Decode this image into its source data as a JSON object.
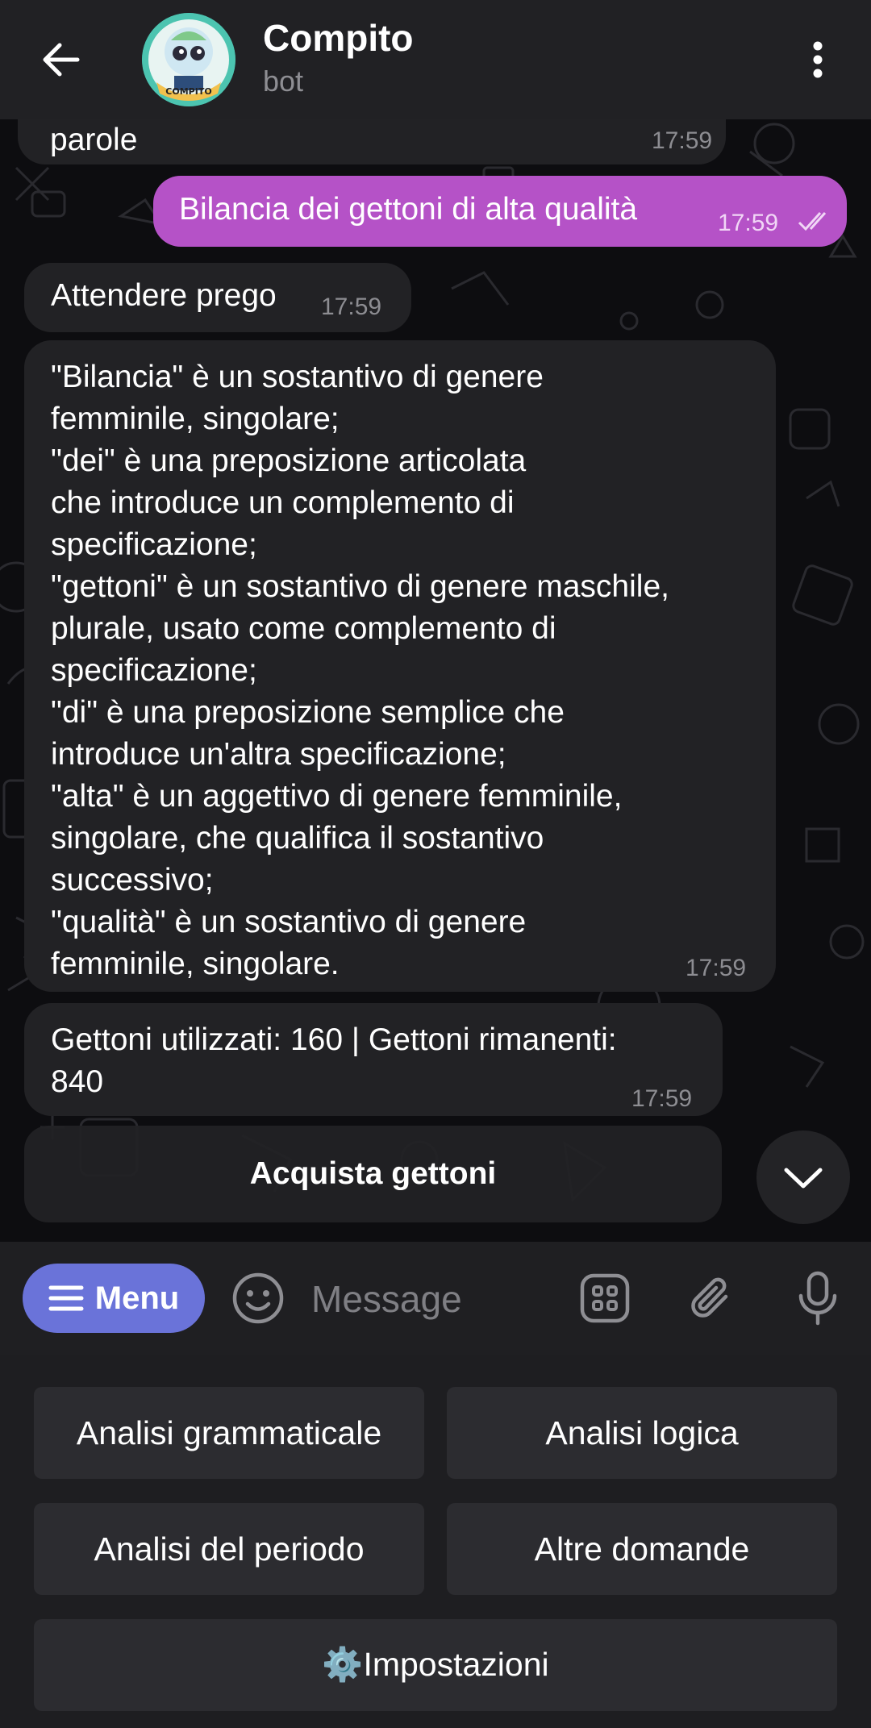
{
  "header": {
    "title": "Compito",
    "subtitle": "bot",
    "avatar_text": "COMPITO"
  },
  "messages": [
    {
      "type": "in",
      "text": "parole",
      "time": "17:59"
    },
    {
      "type": "out",
      "text": "Bilancia dei gettoni di alta qualità",
      "time": "17:59"
    },
    {
      "type": "in",
      "text": "Attendere prego",
      "time": "17:59"
    },
    {
      "type": "in",
      "lines": [
        "\"Bilancia\" è un sostantivo di genere",
        "femminile, singolare;",
        "\"dei\" è una preposizione articolata",
        "che introduce un complemento di",
        "specificazione;",
        "\"gettoni\" è un sostantivo di genere maschile,",
        "plurale, usato come complemento di",
        "specificazione;",
        "\"di\" è una preposizione semplice che",
        "introduce un'altra specificazione;",
        "\"alta\" è un aggettivo di genere femminile,",
        "singolare, che qualifica il sostantivo",
        "successivo;",
        "\"qualità\" è un sostantivo di genere",
        "femminile, singolare."
      ],
      "time": "17:59"
    },
    {
      "type": "in",
      "lines": [
        "Gettoni utilizzati: 160 | Gettoni rimanenti:",
        "840"
      ],
      "time": "17:59"
    }
  ],
  "inline_button": "Acquista gettoni",
  "input_bar": {
    "menu_label": "Menu",
    "placeholder": "Message"
  },
  "reply_keyboard": {
    "row1": [
      "Analisi grammaticale",
      "Analisi logica"
    ],
    "row2": [
      "Analisi del periodo",
      "Altre domande"
    ],
    "row3": "⚙️Impostazioni"
  },
  "colors": {
    "header_bg": "#212124",
    "incoming_bubble": "#222225",
    "outgoing_bubble": "#b552c7",
    "menu_button": "#6a73d9",
    "keyboard_button": "#2c2c30"
  },
  "icons": [
    "back-arrow-icon",
    "more-vertical-icon",
    "double-check-icon",
    "chevron-down-icon",
    "hamburger-icon",
    "emoji-icon",
    "bot-commands-icon",
    "attach-icon",
    "microphone-icon"
  ]
}
